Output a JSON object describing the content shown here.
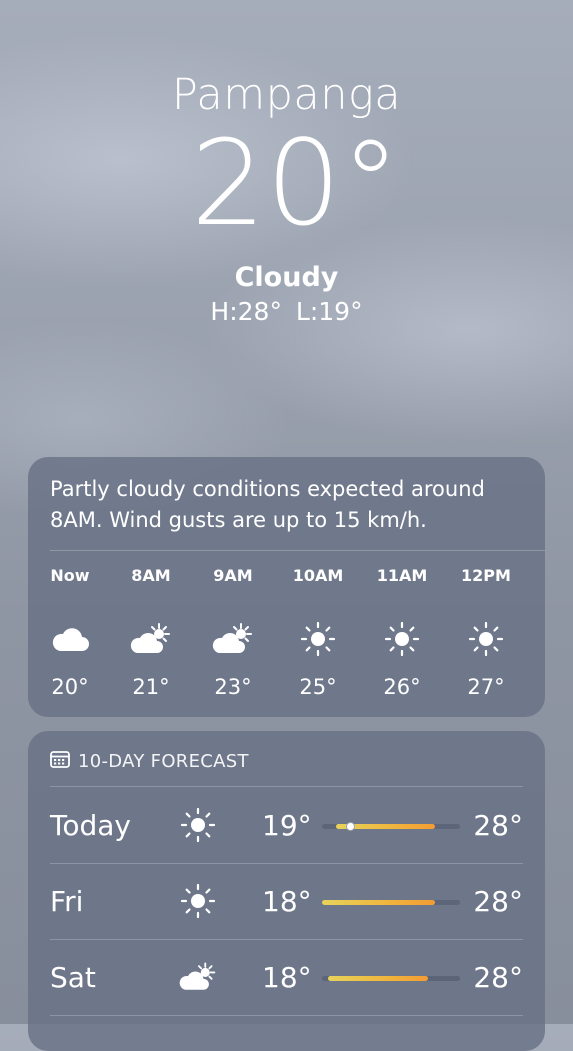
{
  "location": {
    "city": "Pampanga",
    "temperature": "20°",
    "condition": "Cloudy",
    "high_low": "H:28°  L:19°"
  },
  "hourly_card": {
    "summary": "Partly cloudy conditions expected around 8AM. Wind gusts are up to 15 km/h.",
    "hours": [
      {
        "time": "Now",
        "icon": "cloud-icon",
        "temp": "20°"
      },
      {
        "time": "8AM",
        "icon": "partly-cloudy-icon",
        "temp": "21°"
      },
      {
        "time": "9AM",
        "icon": "partly-cloudy-icon",
        "temp": "23°"
      },
      {
        "time": "10AM",
        "icon": "sun-icon",
        "temp": "25°"
      },
      {
        "time": "11AM",
        "icon": "sun-icon",
        "temp": "26°"
      },
      {
        "time": "12PM",
        "icon": "sun-icon",
        "temp": "27°"
      }
    ]
  },
  "forecast_card": {
    "title": "10-DAY FORECAST",
    "icon": "calendar-icon",
    "days": [
      {
        "day": "Today",
        "icon": "sun-icon",
        "low": "19°",
        "high": "28°",
        "range_start": 0.1,
        "range_end": 0.82,
        "current": 0.21
      },
      {
        "day": "Fri",
        "icon": "sun-icon",
        "low": "18°",
        "high": "28°",
        "range_start": 0.0,
        "range_end": 0.82
      },
      {
        "day": "Sat",
        "icon": "partly-cloudy-icon",
        "low": "18°",
        "high": "28°",
        "range_start": 0.04,
        "range_end": 0.77
      }
    ]
  },
  "colors": {
    "card_background": "#66708499",
    "range_start": "#e7d35b",
    "range_end": "#f39c34"
  }
}
